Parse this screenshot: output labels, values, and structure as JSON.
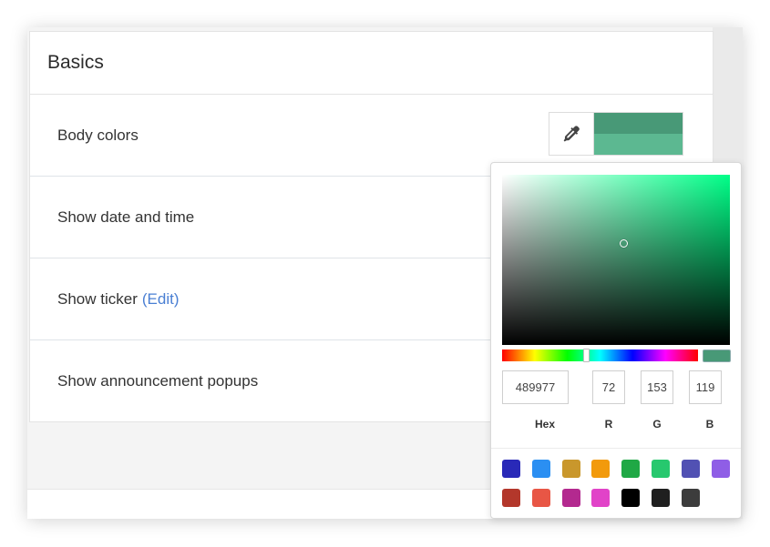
{
  "card": {
    "title": "Basics",
    "rows": [
      {
        "label": "Body colors"
      },
      {
        "label": "Show date and time"
      },
      {
        "label": "Show ticker",
        "link": "(Edit)"
      },
      {
        "label": "Show announcement popups"
      }
    ]
  },
  "body_colors": {
    "primary": "#489977",
    "secondary": "#5cb891"
  },
  "picker": {
    "hue_color": "#00ff88",
    "hex_value": "489977",
    "r_value": "72",
    "g_value": "153",
    "b_value": "119",
    "labels": {
      "hex": "Hex",
      "r": "R",
      "g": "G",
      "b": "B"
    },
    "presets": [
      "#2929b8",
      "#2b8ff2",
      "#c9972c",
      "#f29a0c",
      "#1fa845",
      "#27c86e",
      "#5151b3",
      "#8f5ee6",
      "#b3372b",
      "#e85645",
      "#b3298f",
      "#e143c8",
      "#000000",
      "#1f1f1f",
      "#3c3c3c"
    ]
  }
}
